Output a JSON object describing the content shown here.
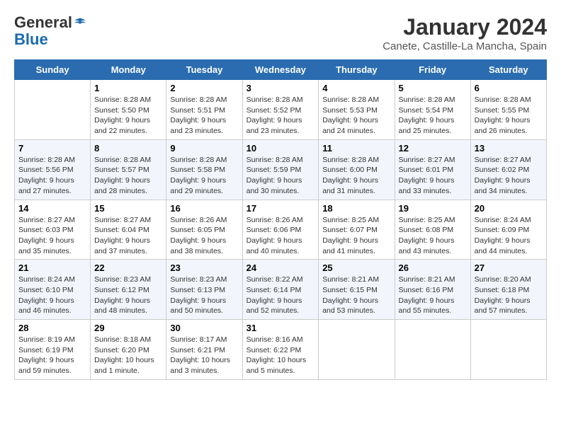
{
  "logo": {
    "general": "General",
    "blue": "Blue"
  },
  "calendar": {
    "title": "January 2024",
    "subtitle": "Canete, Castille-La Mancha, Spain"
  },
  "weekdays": [
    "Sunday",
    "Monday",
    "Tuesday",
    "Wednesday",
    "Thursday",
    "Friday",
    "Saturday"
  ],
  "weeks": [
    [
      {
        "day": "",
        "info": ""
      },
      {
        "day": "1",
        "info": "Sunrise: 8:28 AM\nSunset: 5:50 PM\nDaylight: 9 hours\nand 22 minutes."
      },
      {
        "day": "2",
        "info": "Sunrise: 8:28 AM\nSunset: 5:51 PM\nDaylight: 9 hours\nand 23 minutes."
      },
      {
        "day": "3",
        "info": "Sunrise: 8:28 AM\nSunset: 5:52 PM\nDaylight: 9 hours\nand 23 minutes."
      },
      {
        "day": "4",
        "info": "Sunrise: 8:28 AM\nSunset: 5:53 PM\nDaylight: 9 hours\nand 24 minutes."
      },
      {
        "day": "5",
        "info": "Sunrise: 8:28 AM\nSunset: 5:54 PM\nDaylight: 9 hours\nand 25 minutes."
      },
      {
        "day": "6",
        "info": "Sunrise: 8:28 AM\nSunset: 5:55 PM\nDaylight: 9 hours\nand 26 minutes."
      }
    ],
    [
      {
        "day": "7",
        "info": "Sunrise: 8:28 AM\nSunset: 5:56 PM\nDaylight: 9 hours\nand 27 minutes."
      },
      {
        "day": "8",
        "info": "Sunrise: 8:28 AM\nSunset: 5:57 PM\nDaylight: 9 hours\nand 28 minutes."
      },
      {
        "day": "9",
        "info": "Sunrise: 8:28 AM\nSunset: 5:58 PM\nDaylight: 9 hours\nand 29 minutes."
      },
      {
        "day": "10",
        "info": "Sunrise: 8:28 AM\nSunset: 5:59 PM\nDaylight: 9 hours\nand 30 minutes."
      },
      {
        "day": "11",
        "info": "Sunrise: 8:28 AM\nSunset: 6:00 PM\nDaylight: 9 hours\nand 31 minutes."
      },
      {
        "day": "12",
        "info": "Sunrise: 8:27 AM\nSunset: 6:01 PM\nDaylight: 9 hours\nand 33 minutes."
      },
      {
        "day": "13",
        "info": "Sunrise: 8:27 AM\nSunset: 6:02 PM\nDaylight: 9 hours\nand 34 minutes."
      }
    ],
    [
      {
        "day": "14",
        "info": "Sunrise: 8:27 AM\nSunset: 6:03 PM\nDaylight: 9 hours\nand 35 minutes."
      },
      {
        "day": "15",
        "info": "Sunrise: 8:27 AM\nSunset: 6:04 PM\nDaylight: 9 hours\nand 37 minutes."
      },
      {
        "day": "16",
        "info": "Sunrise: 8:26 AM\nSunset: 6:05 PM\nDaylight: 9 hours\nand 38 minutes."
      },
      {
        "day": "17",
        "info": "Sunrise: 8:26 AM\nSunset: 6:06 PM\nDaylight: 9 hours\nand 40 minutes."
      },
      {
        "day": "18",
        "info": "Sunrise: 8:25 AM\nSunset: 6:07 PM\nDaylight: 9 hours\nand 41 minutes."
      },
      {
        "day": "19",
        "info": "Sunrise: 8:25 AM\nSunset: 6:08 PM\nDaylight: 9 hours\nand 43 minutes."
      },
      {
        "day": "20",
        "info": "Sunrise: 8:24 AM\nSunset: 6:09 PM\nDaylight: 9 hours\nand 44 minutes."
      }
    ],
    [
      {
        "day": "21",
        "info": "Sunrise: 8:24 AM\nSunset: 6:10 PM\nDaylight: 9 hours\nand 46 minutes."
      },
      {
        "day": "22",
        "info": "Sunrise: 8:23 AM\nSunset: 6:12 PM\nDaylight: 9 hours\nand 48 minutes."
      },
      {
        "day": "23",
        "info": "Sunrise: 8:23 AM\nSunset: 6:13 PM\nDaylight: 9 hours\nand 50 minutes."
      },
      {
        "day": "24",
        "info": "Sunrise: 8:22 AM\nSunset: 6:14 PM\nDaylight: 9 hours\nand 52 minutes."
      },
      {
        "day": "25",
        "info": "Sunrise: 8:21 AM\nSunset: 6:15 PM\nDaylight: 9 hours\nand 53 minutes."
      },
      {
        "day": "26",
        "info": "Sunrise: 8:21 AM\nSunset: 6:16 PM\nDaylight: 9 hours\nand 55 minutes."
      },
      {
        "day": "27",
        "info": "Sunrise: 8:20 AM\nSunset: 6:18 PM\nDaylight: 9 hours\nand 57 minutes."
      }
    ],
    [
      {
        "day": "28",
        "info": "Sunrise: 8:19 AM\nSunset: 6:19 PM\nDaylight: 9 hours\nand 59 minutes."
      },
      {
        "day": "29",
        "info": "Sunrise: 8:18 AM\nSunset: 6:20 PM\nDaylight: 10 hours\nand 1 minute."
      },
      {
        "day": "30",
        "info": "Sunrise: 8:17 AM\nSunset: 6:21 PM\nDaylight: 10 hours\nand 3 minutes."
      },
      {
        "day": "31",
        "info": "Sunrise: 8:16 AM\nSunset: 6:22 PM\nDaylight: 10 hours\nand 5 minutes."
      },
      {
        "day": "",
        "info": ""
      },
      {
        "day": "",
        "info": ""
      },
      {
        "day": "",
        "info": ""
      }
    ]
  ]
}
